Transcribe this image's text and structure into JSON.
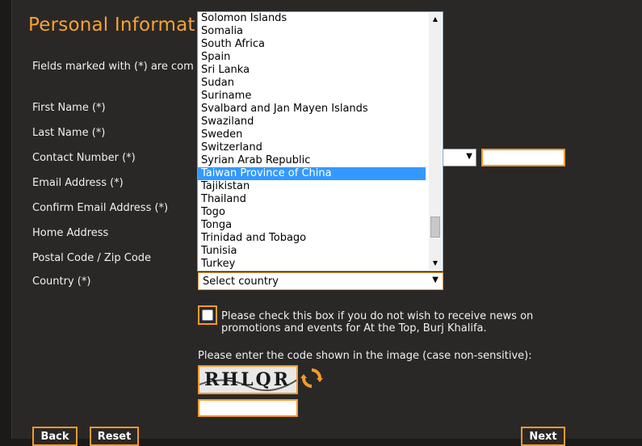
{
  "page": {
    "title": "Personal Informat",
    "note": "Fields marked with (*) are com"
  },
  "form": {
    "labels": {
      "first_name": "First Name (*)",
      "last_name": "Last Name (*)",
      "contact_number": "Contact Number (*)",
      "email": "Email Address (*)",
      "confirm_email": "Confirm Email Address (*)",
      "home_address": "Home Address",
      "postal_code": "Postal Code / Zip Code",
      "country": "Country (*)"
    },
    "country_select": {
      "value": "Select country",
      "options_visible": [
        "Solomon Islands",
        "Somalia",
        "South Africa",
        "Spain",
        "Sri Lanka",
        "Sudan",
        "Suriname",
        "Svalbard and Jan Mayen Islands",
        "Swaziland",
        "Sweden",
        "Switzerland",
        "Syrian Arab Republic",
        "Taiwan Province of China",
        "Tajikistan",
        "Thailand",
        "Togo",
        "Tonga",
        "Trinidad and Tobago",
        "Tunisia",
        "Turkey"
      ],
      "highlighted": "Taiwan Province of China"
    },
    "newsletter_optout": {
      "checked": false,
      "text": "Please check this box if you do not wish to receive news on promotions and events for At the Top, Burj Khalifa."
    },
    "captcha": {
      "label": "Please enter the code shown in the image (case non-sensitive):",
      "code_image_text": "RHLQR"
    }
  },
  "buttons": {
    "back": "Back",
    "reset": "Reset",
    "next": "Next"
  },
  "colors": {
    "accent": "#f39a2e",
    "background": "#2a2827",
    "selected_option": "#3399ff"
  }
}
